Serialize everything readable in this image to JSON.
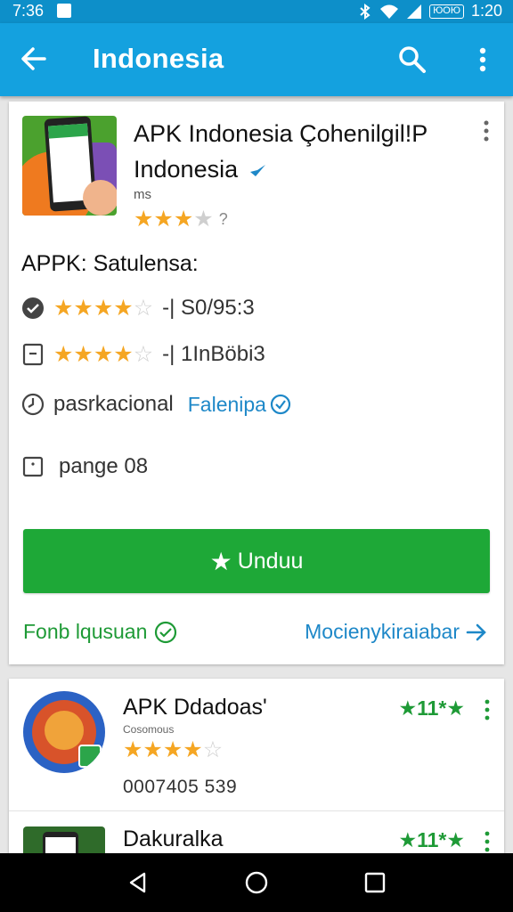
{
  "status": {
    "time": "7:36",
    "battery": "ЮОЮ",
    "clock": "1:20"
  },
  "appbar": {
    "title": "Indonesia"
  },
  "app": {
    "title_line1": "APK Indonesia Çohenilgil!P",
    "title_line2": "Indonesia",
    "meta": "ms",
    "rating_suffix": "?",
    "rating": 3
  },
  "section": {
    "title": "APPK: Satulensa:",
    "rows": [
      {
        "icon": "shield-check-icon",
        "stars": 4,
        "text": "-| S0/95:3"
      },
      {
        "icon": "document-icon",
        "stars": 4,
        "text": "-| 1InBöbi3"
      },
      {
        "icon": "clock-icon",
        "text": "pasrkacional",
        "link": "Falenipa"
      },
      {
        "icon": "info-icon",
        "text": "pange 08"
      }
    ]
  },
  "download_button": {
    "label": "Unduu"
  },
  "footer": {
    "left": "Fonb lqusuan",
    "right": "Mocienykiraiabar"
  },
  "list": [
    {
      "title": "APK Ddadoas'",
      "subtitle": "Cosomous",
      "count": "0007405 539",
      "rating": "★11*★",
      "stars": 4
    },
    {
      "title": "Dakuralka",
      "rating": "★11*★"
    }
  ],
  "colors": {
    "primary": "#14a1df",
    "accent_green": "#1ea837",
    "link_blue": "#1e88c8",
    "star": "#f5a623"
  }
}
